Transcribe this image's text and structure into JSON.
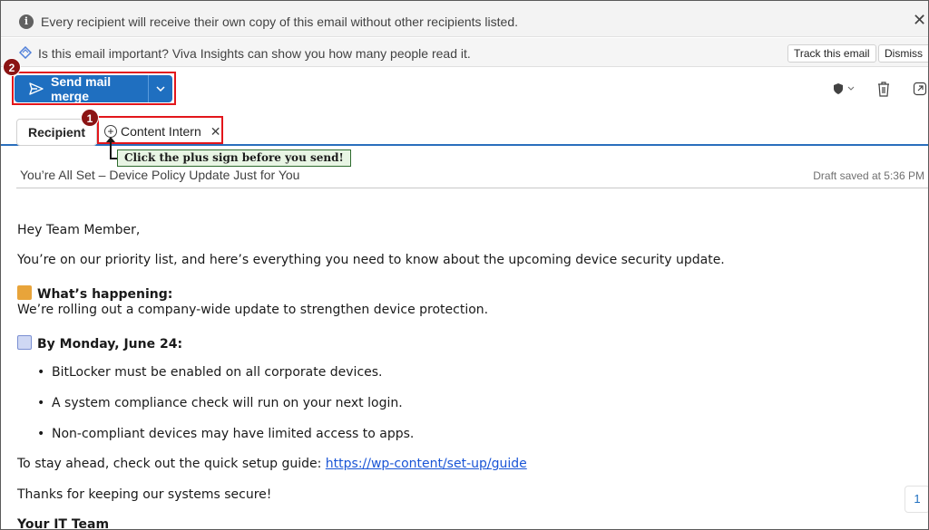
{
  "infobar": {
    "text": "Every recipient will receive their own copy of this email without other recipients listed.",
    "close_glyph": "✕"
  },
  "vivabar": {
    "text": "Is this email important? Viva Insights can show you how many people read it.",
    "track_label": "Track this email",
    "dismiss_label": "Dismiss"
  },
  "toolbar": {
    "send_label": "Send mail merge",
    "badge": "2"
  },
  "recipients": {
    "label": "Recipient",
    "chip": "Content Intern",
    "badge": "1"
  },
  "callout": {
    "text": "Click the plus sign before you send!"
  },
  "subject": {
    "text": "You’re All Set – Device Policy Update Just for You",
    "draft_status": "Draft saved at 5:36 PM"
  },
  "body": {
    "greeting": "Hey Team Member,",
    "intro": "You’re on our priority list, and here’s everything you need to know about the upcoming device security update.",
    "happening_heading": "What’s happening:",
    "happening_text": "We’re rolling out a company-wide update to strengthen device protection.",
    "deadline_heading": "By Monday, June 24:",
    "bullets": [
      "BitLocker must be enabled on all corporate devices.",
      "A system compliance check will run on your next login.",
      "Non-compliant devices may have limited access to apps."
    ],
    "guide_prefix": "To stay ahead, check out the quick setup guide: ",
    "guide_link": "https://wp-content/set-up/guide",
    "thanks": "Thanks for keeping our systems secure!",
    "signature": "Your IT Team"
  },
  "page_indicator": "1",
  "colors": {
    "accent": "#1f6fc0",
    "highlight": "#e3161b",
    "badge": "#8b1414",
    "callout_bg": "#e8f5e4"
  },
  "icons": [
    "info-icon",
    "close-icon",
    "viva-insights-icon",
    "send-icon",
    "chevron-down-icon",
    "sensitivity-icon",
    "trash-icon",
    "popout-icon",
    "plus-circle-icon",
    "lock-emoji-icon",
    "calendar-emoji-icon"
  ]
}
